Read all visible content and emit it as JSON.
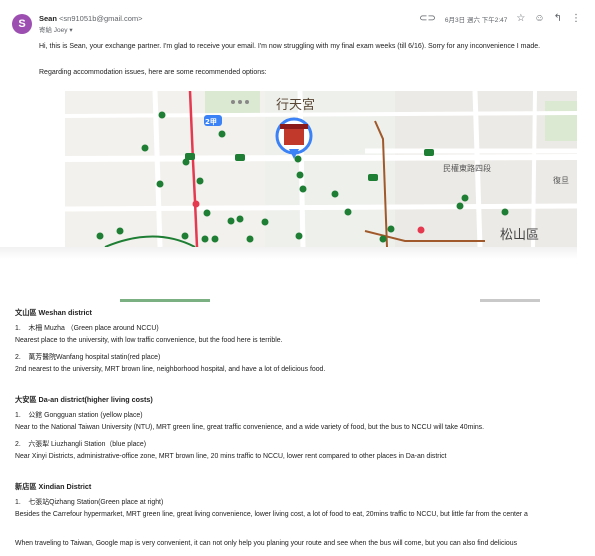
{
  "email": {
    "avatar_letter": "S",
    "sender_name": "Sean",
    "sender_email": "<sn91051b@gmail.com>",
    "to_line": "寄給 Joey ▾",
    "date": "6月3日 週六 下午2:47",
    "greeting": "Hi, this is Sean, your exchange partner. I'm glad to receive your email. I'm now struggling with my final exam weeks (till 6/16). Sorry for any inconvenience I made.",
    "intro": "Regarding accommodation issues, here are some recommended options:"
  },
  "map": {
    "labels": {
      "temple": "行天宮",
      "road": "民權東路四段",
      "district": "松山區",
      "side": "復旦"
    },
    "route_badge": "2甲",
    "colors": {
      "green_dot": "#1e7e34",
      "red_line": "#e53950",
      "brown_line": "#a0592b",
      "road": "#ffffff",
      "blue_route": "#3b82f6"
    }
  },
  "districts": [
    {
      "heading": "文山區 Weshan district",
      "items": [
        {
          "num": "1.",
          "name": "木柵 Muzha （Green place around NCCU)",
          "desc": "Nearest place to the university, with low traffic convenience, but the food here is terrible."
        },
        {
          "num": "2.",
          "name": "萬芳醫院Wanfang hospital statin(red place)",
          "desc": "2nd nearest to the university, MRT brown line, neighborhood hospital, and have a lot of delicious food."
        }
      ]
    },
    {
      "heading": "大安區 Da-an district(higher living costs)",
      "items": [
        {
          "num": "1.",
          "name": "公館 Gongguan station (yellow place)",
          "desc": "Near to the National Taiwan University (NTU), MRT green line, great traffic convenience, and a wide variety of food, but the bus to NCCU will take 40mins."
        },
        {
          "num": "2.",
          "name": "六張犁 Liuzhangli Station（blue place)",
          "desc": "Near Xinyi Districts, administrative-office zone, MRT brown line, 20 mins traffic to NCCU, lower rent compared to other places in Da-an district"
        }
      ]
    },
    {
      "heading": "新店區 Xindian District",
      "items": [
        {
          "num": "1.",
          "name": "七張站Qizhang Station(Green place at right)",
          "desc": "Besides the Carrefour hypermarket, MRT green line, great living convenience, lower living cost, a lot of food to eat, 20mins traffic to NCCU, but little far from the center a"
        }
      ]
    }
  ],
  "closing": "When traveling to Taiwan, Google map is very convenient, it can not only help you planing your route and see when the bus will come, but you can also find delicious"
}
